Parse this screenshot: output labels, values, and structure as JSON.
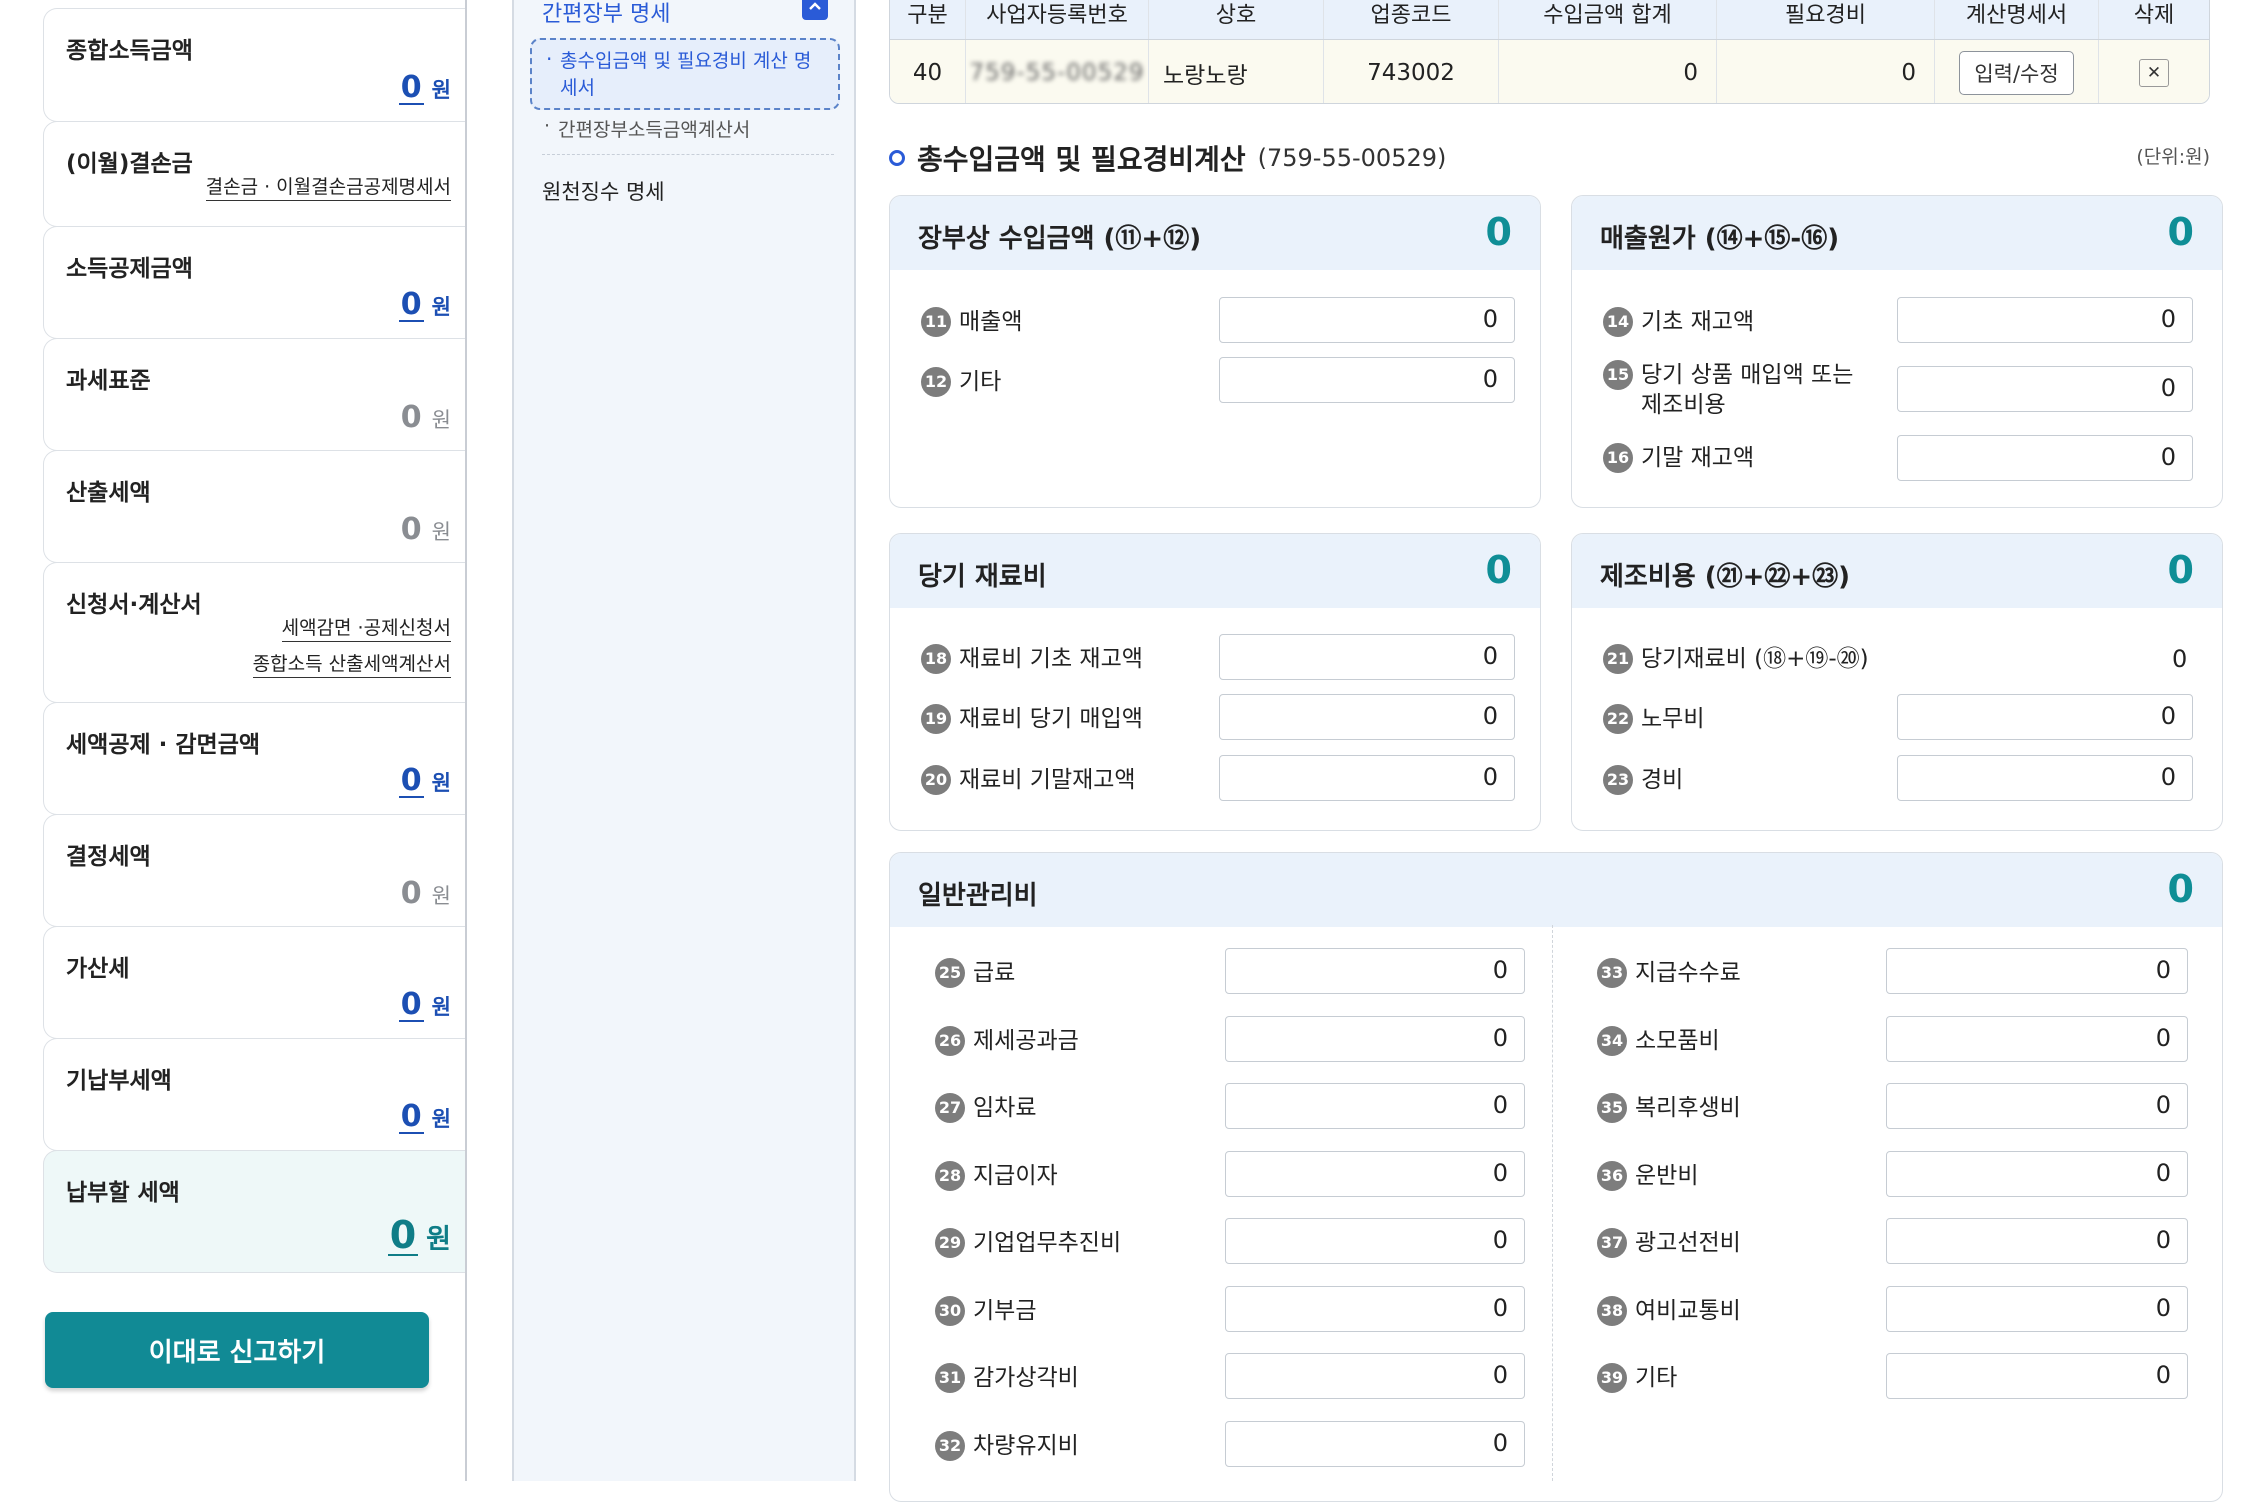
{
  "summary": {
    "total_income": {
      "label": "종합소득금액",
      "value": "0",
      "unit": "원"
    },
    "loss": {
      "label": "(이월)결손금",
      "link": "결손금 · 이월결손금공제명세서"
    },
    "income_deduction": {
      "label": "소득공제금액",
      "value": "0",
      "unit": "원"
    },
    "tax_base": {
      "label": "과세표준",
      "value": "0",
      "unit": "원"
    },
    "calculated_tax": {
      "label": "산출세액",
      "value": "0",
      "unit": "원"
    },
    "forms": {
      "label": "신청서·계산서",
      "link1": "세액감면 ·공제신청서",
      "link2": "종합소득 산출세액계산서"
    },
    "tax_credit": {
      "label": "세액공제 · 감면금액",
      "value": "0",
      "unit": "원"
    },
    "determined_tax": {
      "label": "결정세액",
      "value": "0",
      "unit": "원"
    },
    "penalty": {
      "label": "가산세",
      "value": "0",
      "unit": "원"
    },
    "prepaid": {
      "label": "기납부세액",
      "value": "0",
      "unit": "원"
    },
    "payable": {
      "label": "납부할 세액",
      "value": "0",
      "unit": "원"
    },
    "report_button": "이대로 신고하기"
  },
  "nav": {
    "head": "간편장부 명세",
    "selected": "총수입금액 및 필요경비 계산 명세서",
    "sub": "간편장부소득금액계산서",
    "item": "원천징수 명세"
  },
  "business_table": {
    "headers": [
      "구분",
      "사업자등록번호",
      "상호",
      "업종코드",
      "수입금액 합계",
      "필요경비",
      "계산명세서",
      "삭제"
    ],
    "row": {
      "code": "40",
      "reg_no": "759-55-00529",
      "name": "노랑노랑",
      "industry": "743002",
      "income": "0",
      "expense": "0",
      "edit": "입력/수정"
    }
  },
  "section": {
    "title": "총수입금액 및 필요경비계산",
    "reg_no": "(759-55-00529)",
    "unit_note": "(단위:원)"
  },
  "cards": {
    "book_income": {
      "title": "장부상 수입금액 (⑪+⑫)",
      "total": "0",
      "rows": [
        {
          "num": "11",
          "label": "매출액",
          "value": "0"
        },
        {
          "num": "12",
          "label": "기타",
          "value": "0"
        }
      ]
    },
    "cogs": {
      "title": "매출원가 (⑭+⑮-⑯)",
      "total": "0",
      "rows": [
        {
          "num": "14",
          "label": "기초 재고액",
          "value": "0"
        },
        {
          "num": "15",
          "label": "당기 상품 매입액 또는",
          "label2": "제조비용",
          "value": "0"
        },
        {
          "num": "16",
          "label": "기말 재고액",
          "value": "0"
        }
      ]
    },
    "materials": {
      "title": "당기 재료비",
      "total": "0",
      "rows": [
        {
          "num": "18",
          "label": "재료비 기초 재고액",
          "value": "0"
        },
        {
          "num": "19",
          "label": "재료비 당기 매입액",
          "value": "0"
        },
        {
          "num": "20",
          "label": "재료비 기말재고액",
          "value": "0"
        }
      ]
    },
    "manufacturing": {
      "title": "제조비용 (㉑+㉒+㉓)",
      "total": "0",
      "rows": [
        {
          "num": "21",
          "label": "당기재료비 (⑱+⑲-⑳)",
          "value": "0"
        },
        {
          "num": "22",
          "label": "노무비",
          "value": "0"
        },
        {
          "num": "23",
          "label": "경비",
          "value": "0"
        }
      ]
    },
    "admin": {
      "title": "일반관리비",
      "total": "0",
      "left": [
        {
          "num": "25",
          "label": "급료",
          "value": "0"
        },
        {
          "num": "26",
          "label": "제세공과금",
          "value": "0"
        },
        {
          "num": "27",
          "label": "임차료",
          "value": "0"
        },
        {
          "num": "28",
          "label": "지급이자",
          "value": "0"
        },
        {
          "num": "29",
          "label": "기업업무추진비",
          "value": "0"
        },
        {
          "num": "30",
          "label": "기부금",
          "value": "0"
        },
        {
          "num": "31",
          "label": "감가상각비",
          "value": "0"
        },
        {
          "num": "32",
          "label": "차량유지비",
          "value": "0"
        }
      ],
      "right": [
        {
          "num": "33",
          "label": "지급수수료",
          "value": "0"
        },
        {
          "num": "34",
          "label": "소모품비",
          "value": "0"
        },
        {
          "num": "35",
          "label": "복리후생비",
          "value": "0"
        },
        {
          "num": "36",
          "label": "운반비",
          "value": "0"
        },
        {
          "num": "37",
          "label": "광고선전비",
          "value": "0"
        },
        {
          "num": "38",
          "label": "여비교통비",
          "value": "0"
        },
        {
          "num": "39",
          "label": "기타",
          "value": "0"
        }
      ]
    }
  }
}
